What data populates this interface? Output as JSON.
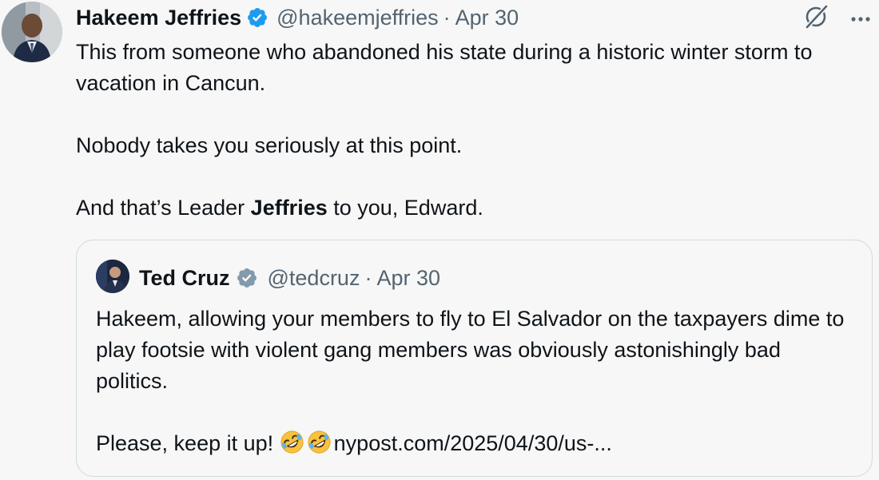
{
  "tweet": {
    "author_name": "Hakeem Jeffries",
    "handle": "@hakeemjeffries",
    "separator": "·",
    "date": "Apr 30",
    "icons": {
      "verified": "verified-badge-icon",
      "grok": "grok-icon",
      "more": "more-options-icon"
    },
    "colors": {
      "verified_blue": "#1d9bf0",
      "secondary_text": "#536471",
      "border": "#cfd9de"
    },
    "body": {
      "line1": "This from someone who abandoned his state during a historic winter storm to vacation in Cancun.",
      "line2": "Nobody takes you seriously at this point.",
      "line3_prefix": "And that’s Leader ",
      "line3_bold": "Jeffries",
      "line3_suffix": " to you, Edward."
    }
  },
  "quoted_tweet": {
    "author_name": "Ted Cruz",
    "handle": "@tedcruz",
    "separator": "·",
    "date": "Apr 30",
    "icons": {
      "verified": "gray-verified-badge-icon",
      "emoji": "rolling-on-floor-laughing-emoji"
    },
    "colors": {
      "verified_gray": "#829aab"
    },
    "body": {
      "para1": "Hakeem, allowing your members to fly to El Salvador on the taxpayers dime to play footsie with violent gang members was obviously astonishingly bad politics.",
      "para2_prefix": "Please, keep it up! ",
      "link": "nypost.com/2025/04/30/us-..."
    }
  }
}
